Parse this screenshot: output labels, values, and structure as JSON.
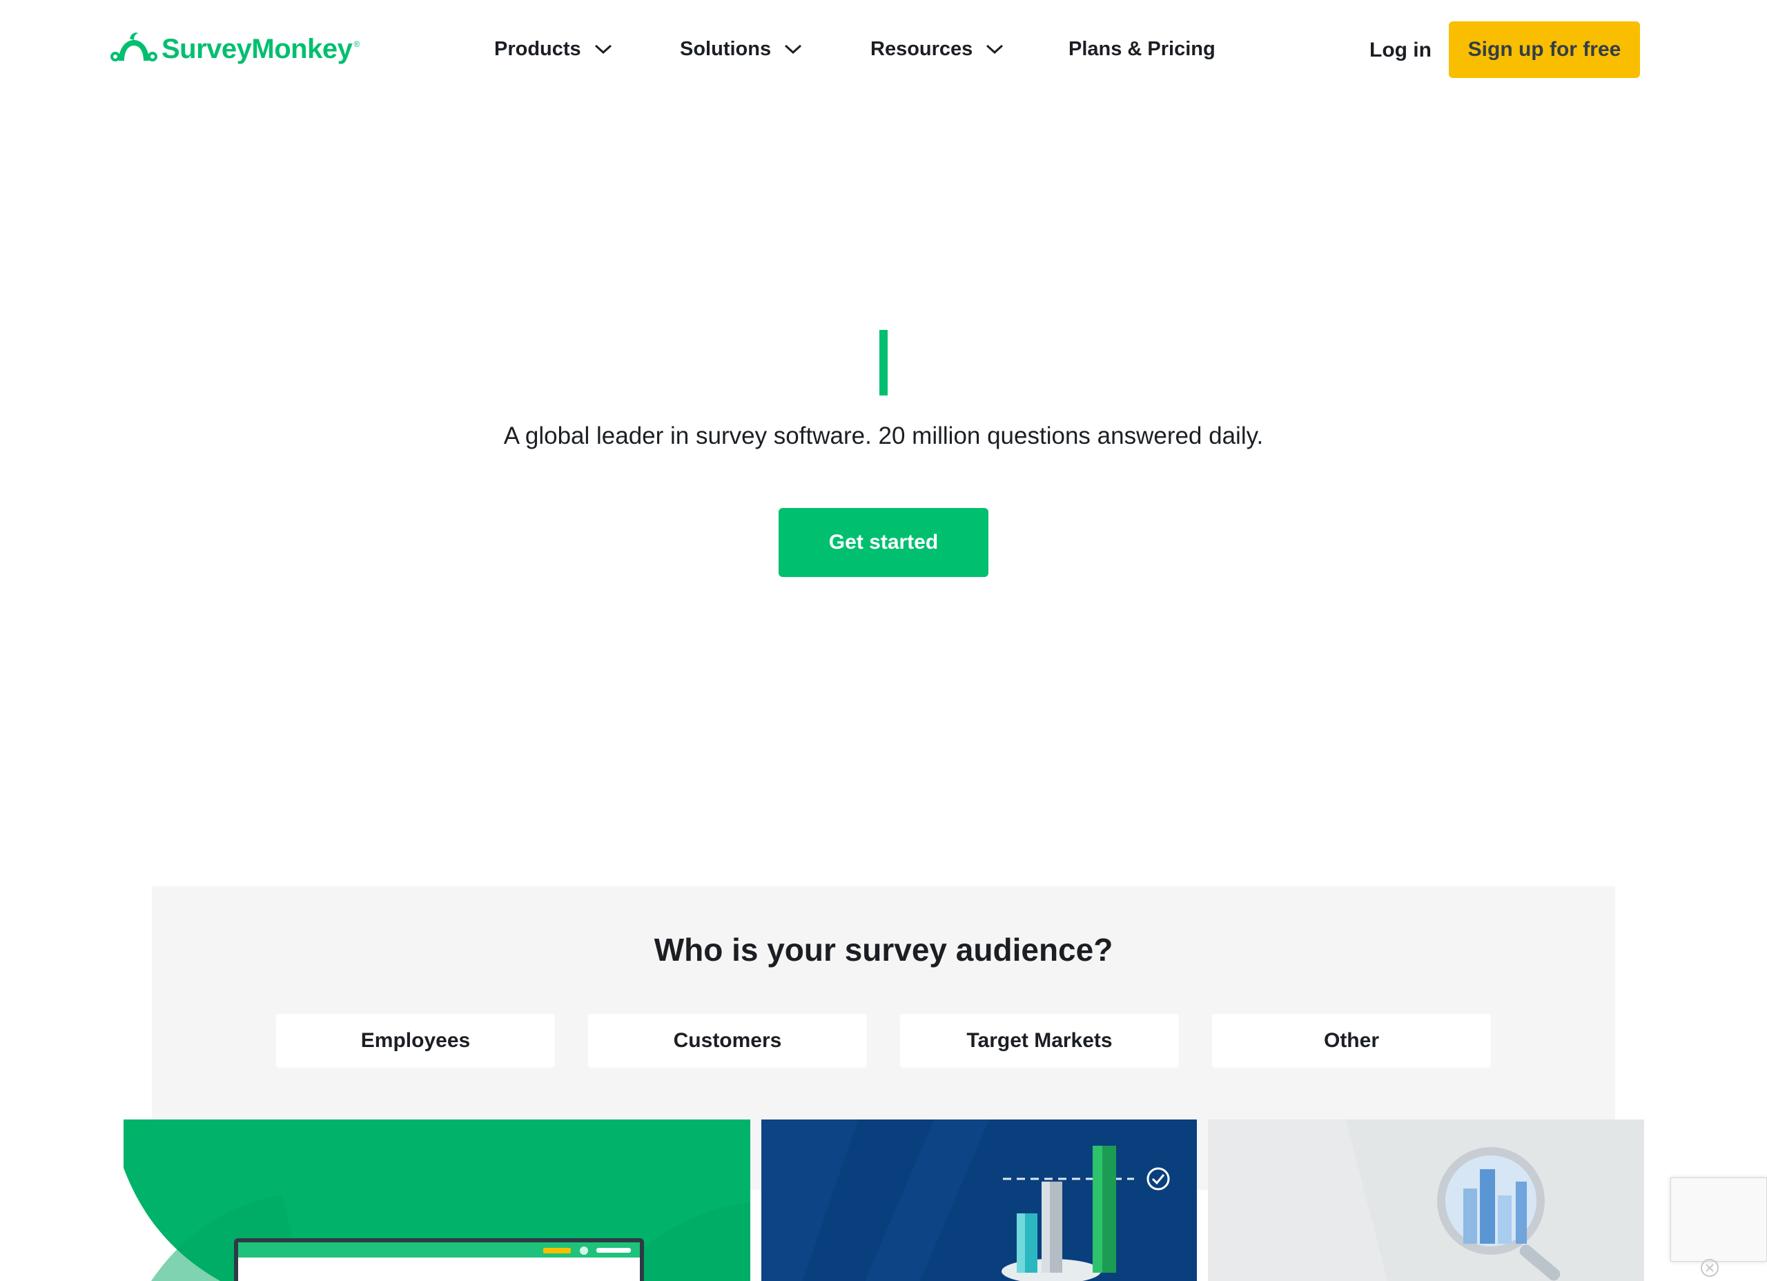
{
  "header": {
    "logo_text": "SurveyMonkey",
    "logo_mark": "®",
    "nav": [
      {
        "label": "Products",
        "icon": "chevron-down-icon"
      },
      {
        "label": "Solutions",
        "icon": "chevron-down-icon"
      },
      {
        "label": "Resources",
        "icon": "chevron-down-icon"
      },
      {
        "label": "Plans & Pricing"
      }
    ],
    "login_label": "Log in",
    "signup_label": "Sign up for free"
  },
  "hero": {
    "tagline": "A global leader in survey software. 20 million questions answered daily.",
    "cta_label": "Get started"
  },
  "audience": {
    "title": "Who is your survey audience?",
    "options": [
      "Employees",
      "Customers",
      "Target Markets",
      "Other"
    ]
  },
  "colors": {
    "brand_green": "#00bf6f",
    "signup_yellow": "#f9be00",
    "card_navy": "#0a3f7d",
    "panel_gray": "#f5f5f5"
  }
}
